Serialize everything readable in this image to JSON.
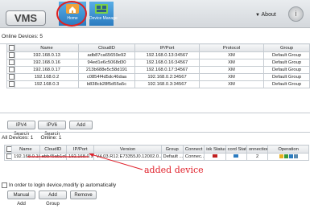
{
  "app": {
    "logo": "VMS"
  },
  "nav": [
    {
      "label": "Home"
    },
    {
      "label": "Device Manage"
    }
  ],
  "about_label": "About",
  "online_devices": {
    "title": "Online Devices:",
    "count": "5",
    "columns": [
      "",
      "Name",
      "CloudID",
      "IP/Port",
      "Protocol",
      "Group"
    ],
    "rows": [
      {
        "name": "192.168.0.13",
        "cloud": "adb87ca65659e92",
        "ip": "192.168.0.13:34567",
        "protocol": "XM",
        "group": "Default Group"
      },
      {
        "name": "192.168.0.16",
        "cloud": "94ed1e6c5068d30",
        "ip": "192.168.0.16:34567",
        "protocol": "XM",
        "group": "Default Group"
      },
      {
        "name": "192.168.0.17",
        "cloud": "213b688e5c58d191",
        "ip": "192.168.0.17:34567",
        "protocol": "XM",
        "group": "Default Group"
      },
      {
        "name": "192.168.0.2",
        "cloud": "c0854f4d5dc46daa",
        "ip": "192.168.0.2:34567",
        "protocol": "XM",
        "group": "Default Group"
      },
      {
        "name": "192.168.0.3",
        "cloud": "b838cb28f5d55a5c",
        "ip": "192.168.0.3:34567",
        "protocol": "XM",
        "group": "Default Group"
      }
    ]
  },
  "search_buttons": {
    "ipv4": "IPV4 Search",
    "ipv6": "IPV6 Search",
    "add": "Add"
  },
  "all_devices": {
    "all_label": "All Devices:",
    "all_count": "1",
    "online_label": "Online:",
    "online_count": "1",
    "columns": [
      "",
      "Name",
      "CloudID",
      "IP/Port",
      "Version",
      "Group",
      "Connect",
      "isk Status",
      "cord Stat",
      "onnection",
      "Operation"
    ],
    "rows": [
      {
        "name": "192.168.0.10",
        "cloud": "ebb45ab1c6...",
        "ip": "192.168.0.10...",
        "version": "V4.03.R12.E73355J0.12002.0...",
        "group": "Default ...",
        "connect": "Connec...",
        "connection": "2"
      }
    ]
  },
  "auto_ip": {
    "label": "In order to login device,modify ip automatically"
  },
  "bottom_buttons": {
    "manual": "Manual Add",
    "group": "Add Group",
    "remove": "Remove"
  },
  "annotation": "added device",
  "colors": {
    "nav_active": "#2a7bc0",
    "annotation": "#e0202a",
    "ring": "#e02020"
  }
}
